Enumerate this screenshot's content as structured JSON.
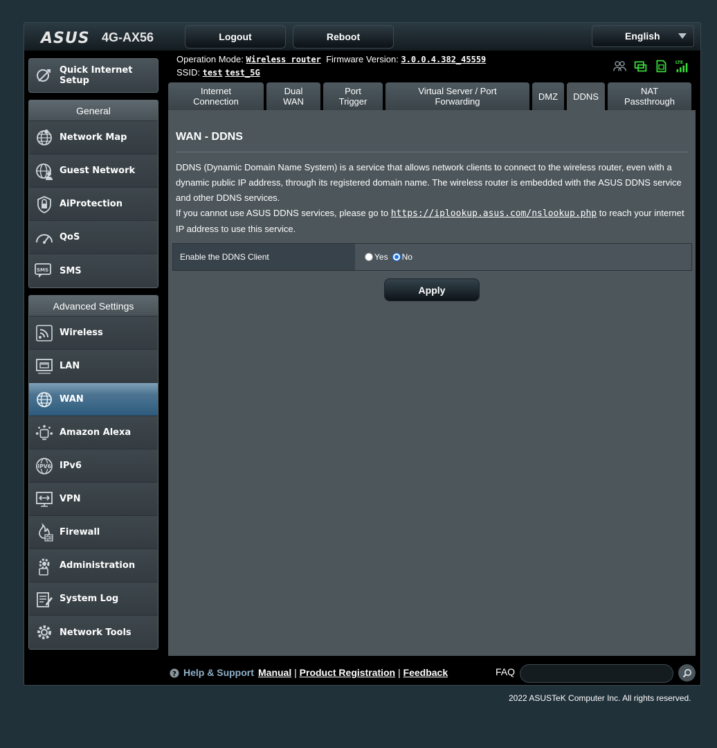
{
  "header": {
    "brand": "ASUS",
    "model": "4G-AX56",
    "logout_label": "Logout",
    "reboot_label": "Reboot",
    "language": "English"
  },
  "status": {
    "operation_mode_label": "Operation Mode:",
    "operation_mode_value": "Wireless router",
    "firmware_label": "Firmware Version:",
    "firmware_value": "3.0.0.4.382_45559",
    "ssid_label": "SSID:",
    "ssid_1": "test",
    "ssid_2": "test_5G",
    "icons": [
      "clients-icon",
      "usb-icon",
      "sim-icon",
      "lte-signal-icon"
    ],
    "lte_label": "LTE"
  },
  "sidebar": {
    "quick_setup_line1": "Quick Internet",
    "quick_setup_line2": "Setup",
    "general_title": "General",
    "general_items": [
      {
        "label": "Network Map",
        "icon": "network-map-icon"
      },
      {
        "label": "Guest Network",
        "icon": "guest-network-icon"
      },
      {
        "label": "AiProtection",
        "icon": "aiprotection-icon"
      },
      {
        "label": "QoS",
        "icon": "qos-icon"
      },
      {
        "label": "SMS",
        "icon": "sms-icon"
      }
    ],
    "sms_badge": "SMS",
    "advanced_title": "Advanced Settings",
    "advanced_items": [
      {
        "label": "Wireless",
        "icon": "wireless-icon"
      },
      {
        "label": "LAN",
        "icon": "lan-icon"
      },
      {
        "label": "WAN",
        "icon": "wan-icon",
        "active": true
      },
      {
        "label": "Amazon Alexa",
        "icon": "alexa-icon"
      },
      {
        "label": "IPv6",
        "icon": "ipv6-icon"
      },
      {
        "label": "VPN",
        "icon": "vpn-icon"
      },
      {
        "label": "Firewall",
        "icon": "firewall-icon"
      },
      {
        "label": "Administration",
        "icon": "administration-icon"
      },
      {
        "label": "System Log",
        "icon": "system-log-icon"
      },
      {
        "label": "Network Tools",
        "icon": "network-tools-icon"
      }
    ]
  },
  "tabs": [
    {
      "line1": "Internet",
      "line2": "Connection"
    },
    {
      "line1": "Dual",
      "line2": "WAN"
    },
    {
      "line1": "Port",
      "line2": "Trigger"
    },
    {
      "line1": "Virtual Server / Port",
      "line2": "Forwarding"
    },
    {
      "line1": "DMZ",
      "line2": ""
    },
    {
      "line1": "DDNS",
      "line2": "",
      "active": true
    },
    {
      "line1": "NAT",
      "line2": "Passthrough"
    }
  ],
  "content": {
    "title": "WAN - DDNS",
    "desc_p1": "DDNS (Dynamic Domain Name System) is a service that allows network clients to connect to the wireless router, even with a dynamic public IP address, through its registered domain name. The wireless router is embedded with the ASUS DDNS service and other DDNS services.",
    "desc_p2_before": "If you cannot use ASUS DDNS services, please go to ",
    "desc_link": "https://iplookup.asus.com/nslookup.php",
    "desc_p2_after": " to reach your internet IP address to use this service.",
    "setting_label": "Enable the DDNS Client",
    "option_yes": "Yes",
    "option_no": "No",
    "selected": "No",
    "apply_label": "Apply"
  },
  "footer": {
    "help_label": "Help & Support",
    "manual": "Manual",
    "product_registration": "Product Registration",
    "feedback": "Feedback",
    "sep": "|",
    "faq_label": "FAQ",
    "faq_placeholder": ""
  },
  "copyright": "2022 ASUSTeK Computer Inc. All rights reserved.",
  "colors": {
    "accent_blue": "#2d5b7d",
    "sim_green": "#3cdc3c",
    "background": "#21313a",
    "panel": "#4d565b"
  }
}
